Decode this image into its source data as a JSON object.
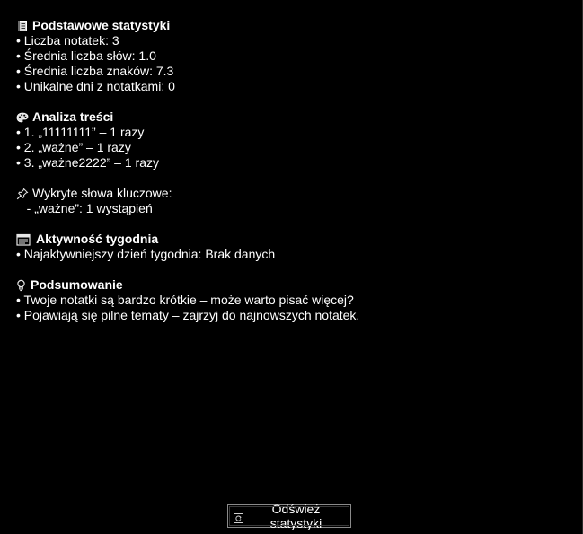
{
  "basic": {
    "title": "Podstawowe statystyki",
    "icon": "notebook-icon",
    "lines": [
      "• Liczba notatek: 3",
      "• Średnia liczba słów: 1.0",
      "• Średnia liczba znaków: 7.3",
      "• Unikalne dni z notatkami: 0"
    ]
  },
  "content_analysis": {
    "title": "Analiza treści",
    "icon": "palette-icon",
    "lines": [
      "• 1. „11111111” – 1 razy",
      "• 2. „ważne” – 1 razy",
      "• 3. „ważne2222” – 1 razy"
    ]
  },
  "keywords": {
    "title": "Wykryte słowa kluczowe:",
    "icon": "pushpin-icon",
    "lines": [
      "   - „ważne”: 1 wystąpień"
    ]
  },
  "weekly": {
    "title": "Aktywność tygodnia",
    "icon": "calendar-icon",
    "lines": [
      "• Najaktywniejszy dzień tygodnia: Brak danych"
    ]
  },
  "summary": {
    "title": "Podsumowanie",
    "icon": "lightbulb-icon",
    "lines": [
      "• Twoje notatki są bardzo krótkie – może warto pisać więcej?",
      "• Pojawiają się pilne tematy – zajrzyj do najnowszych notatek."
    ]
  },
  "refresh_button": {
    "label": "Odśwież statystyki",
    "icon": "refresh-icon"
  },
  "colors": {
    "background": "#000000",
    "text": "#ffffff",
    "button_border": "#8a8a8a"
  }
}
